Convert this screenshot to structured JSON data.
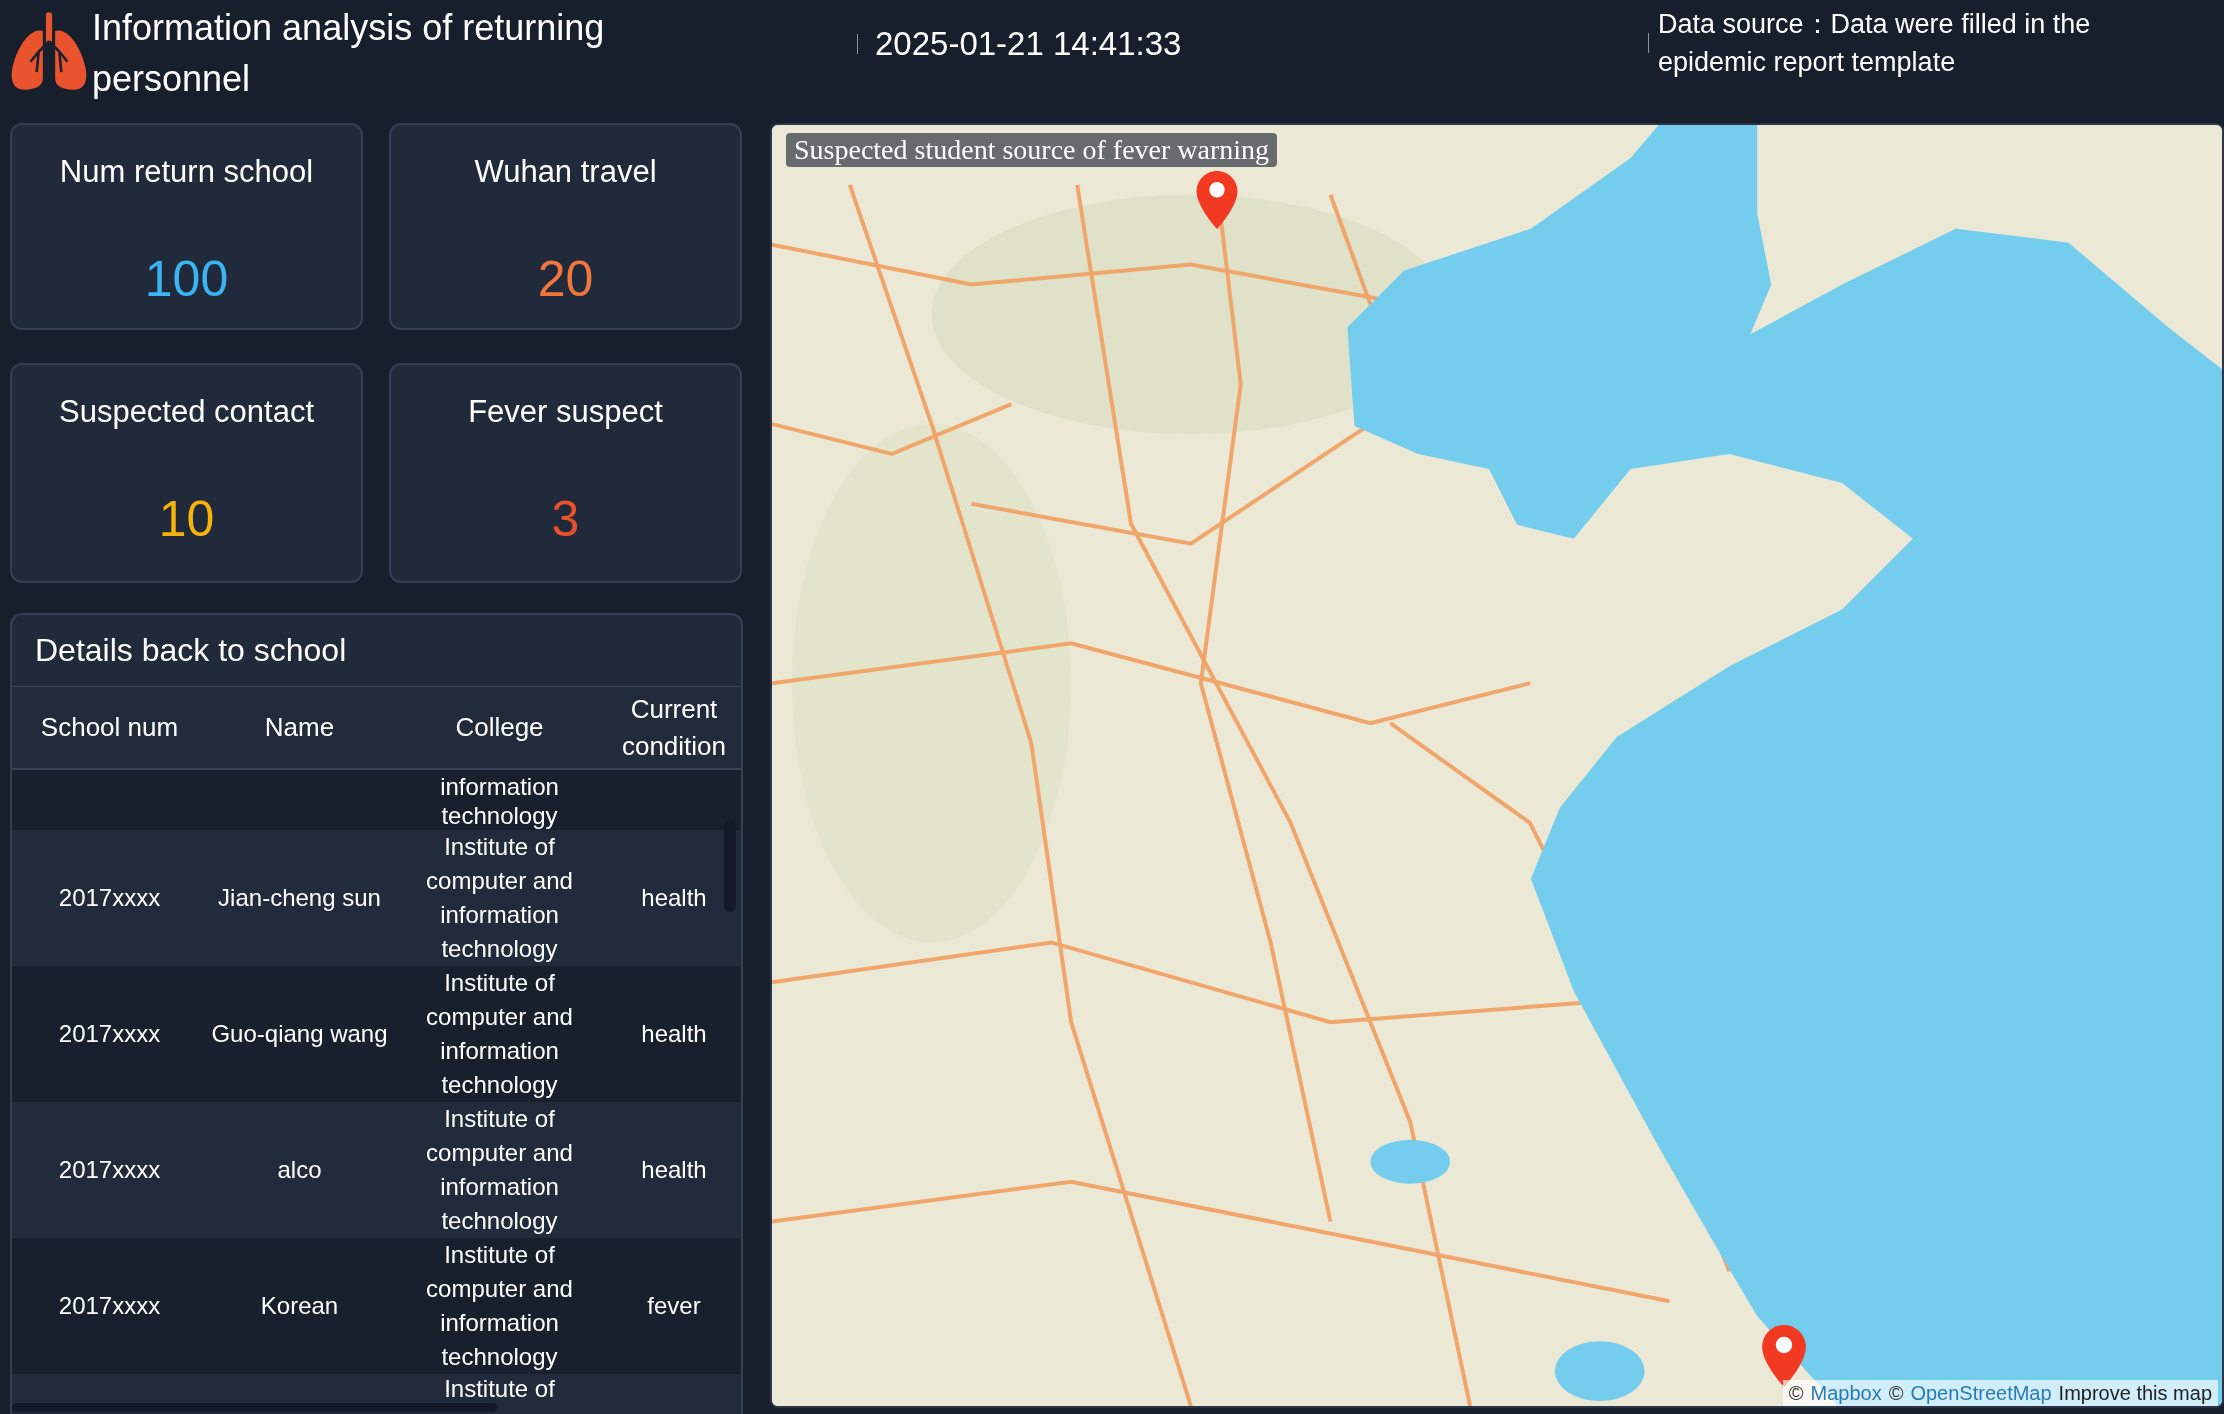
{
  "header": {
    "title": "Information analysis of returning personnel",
    "datetime": "2025-01-21 14:41:33",
    "data_source": "Data source：Data were filled in the epidemic report template"
  },
  "stats": [
    {
      "label": "Num return school",
      "value": "100",
      "color": "#3bb4f2"
    },
    {
      "label": "Wuhan travel",
      "value": "20",
      "color": "#f0763c"
    },
    {
      "label": "Suspected contact",
      "value": "10",
      "color": "#f5b30c"
    },
    {
      "label": "Fever suspect",
      "value": "3",
      "color": "#e8512c"
    }
  ],
  "details": {
    "title": "Details back to school",
    "columns": [
      "School num",
      "Name",
      "College",
      "Current condition"
    ],
    "rows": [
      {
        "kind": "clipped_top",
        "college": "information technology"
      },
      {
        "kind": "full",
        "school_num": "2017xxxx",
        "name": "Jian-cheng sun",
        "college": "Institute of computer and information technology",
        "condition": "health"
      },
      {
        "kind": "full",
        "school_num": "2017xxxx",
        "name": "Guo-qiang wang",
        "college": "Institute of computer and information technology",
        "condition": "health"
      },
      {
        "kind": "full",
        "school_num": "2017xxxx",
        "name": "alco",
        "college": "Institute of computer and information technology",
        "condition": "health"
      },
      {
        "kind": "full",
        "school_num": "2017xxxx",
        "name": "Korean",
        "college": "Institute of computer and information technology",
        "condition": "fever"
      },
      {
        "kind": "clipped_bottom",
        "college": "Institute of"
      }
    ]
  },
  "map": {
    "title": "Suspected student source of fever warning",
    "attribution": [
      {
        "kind": "symbol",
        "text": "©"
      },
      {
        "kind": "link",
        "text": "Mapbox"
      },
      {
        "kind": "symbol",
        "text": "©"
      },
      {
        "kind": "link",
        "text": "OpenStreetMap"
      },
      {
        "kind": "action",
        "text": "Improve this map"
      }
    ]
  }
}
